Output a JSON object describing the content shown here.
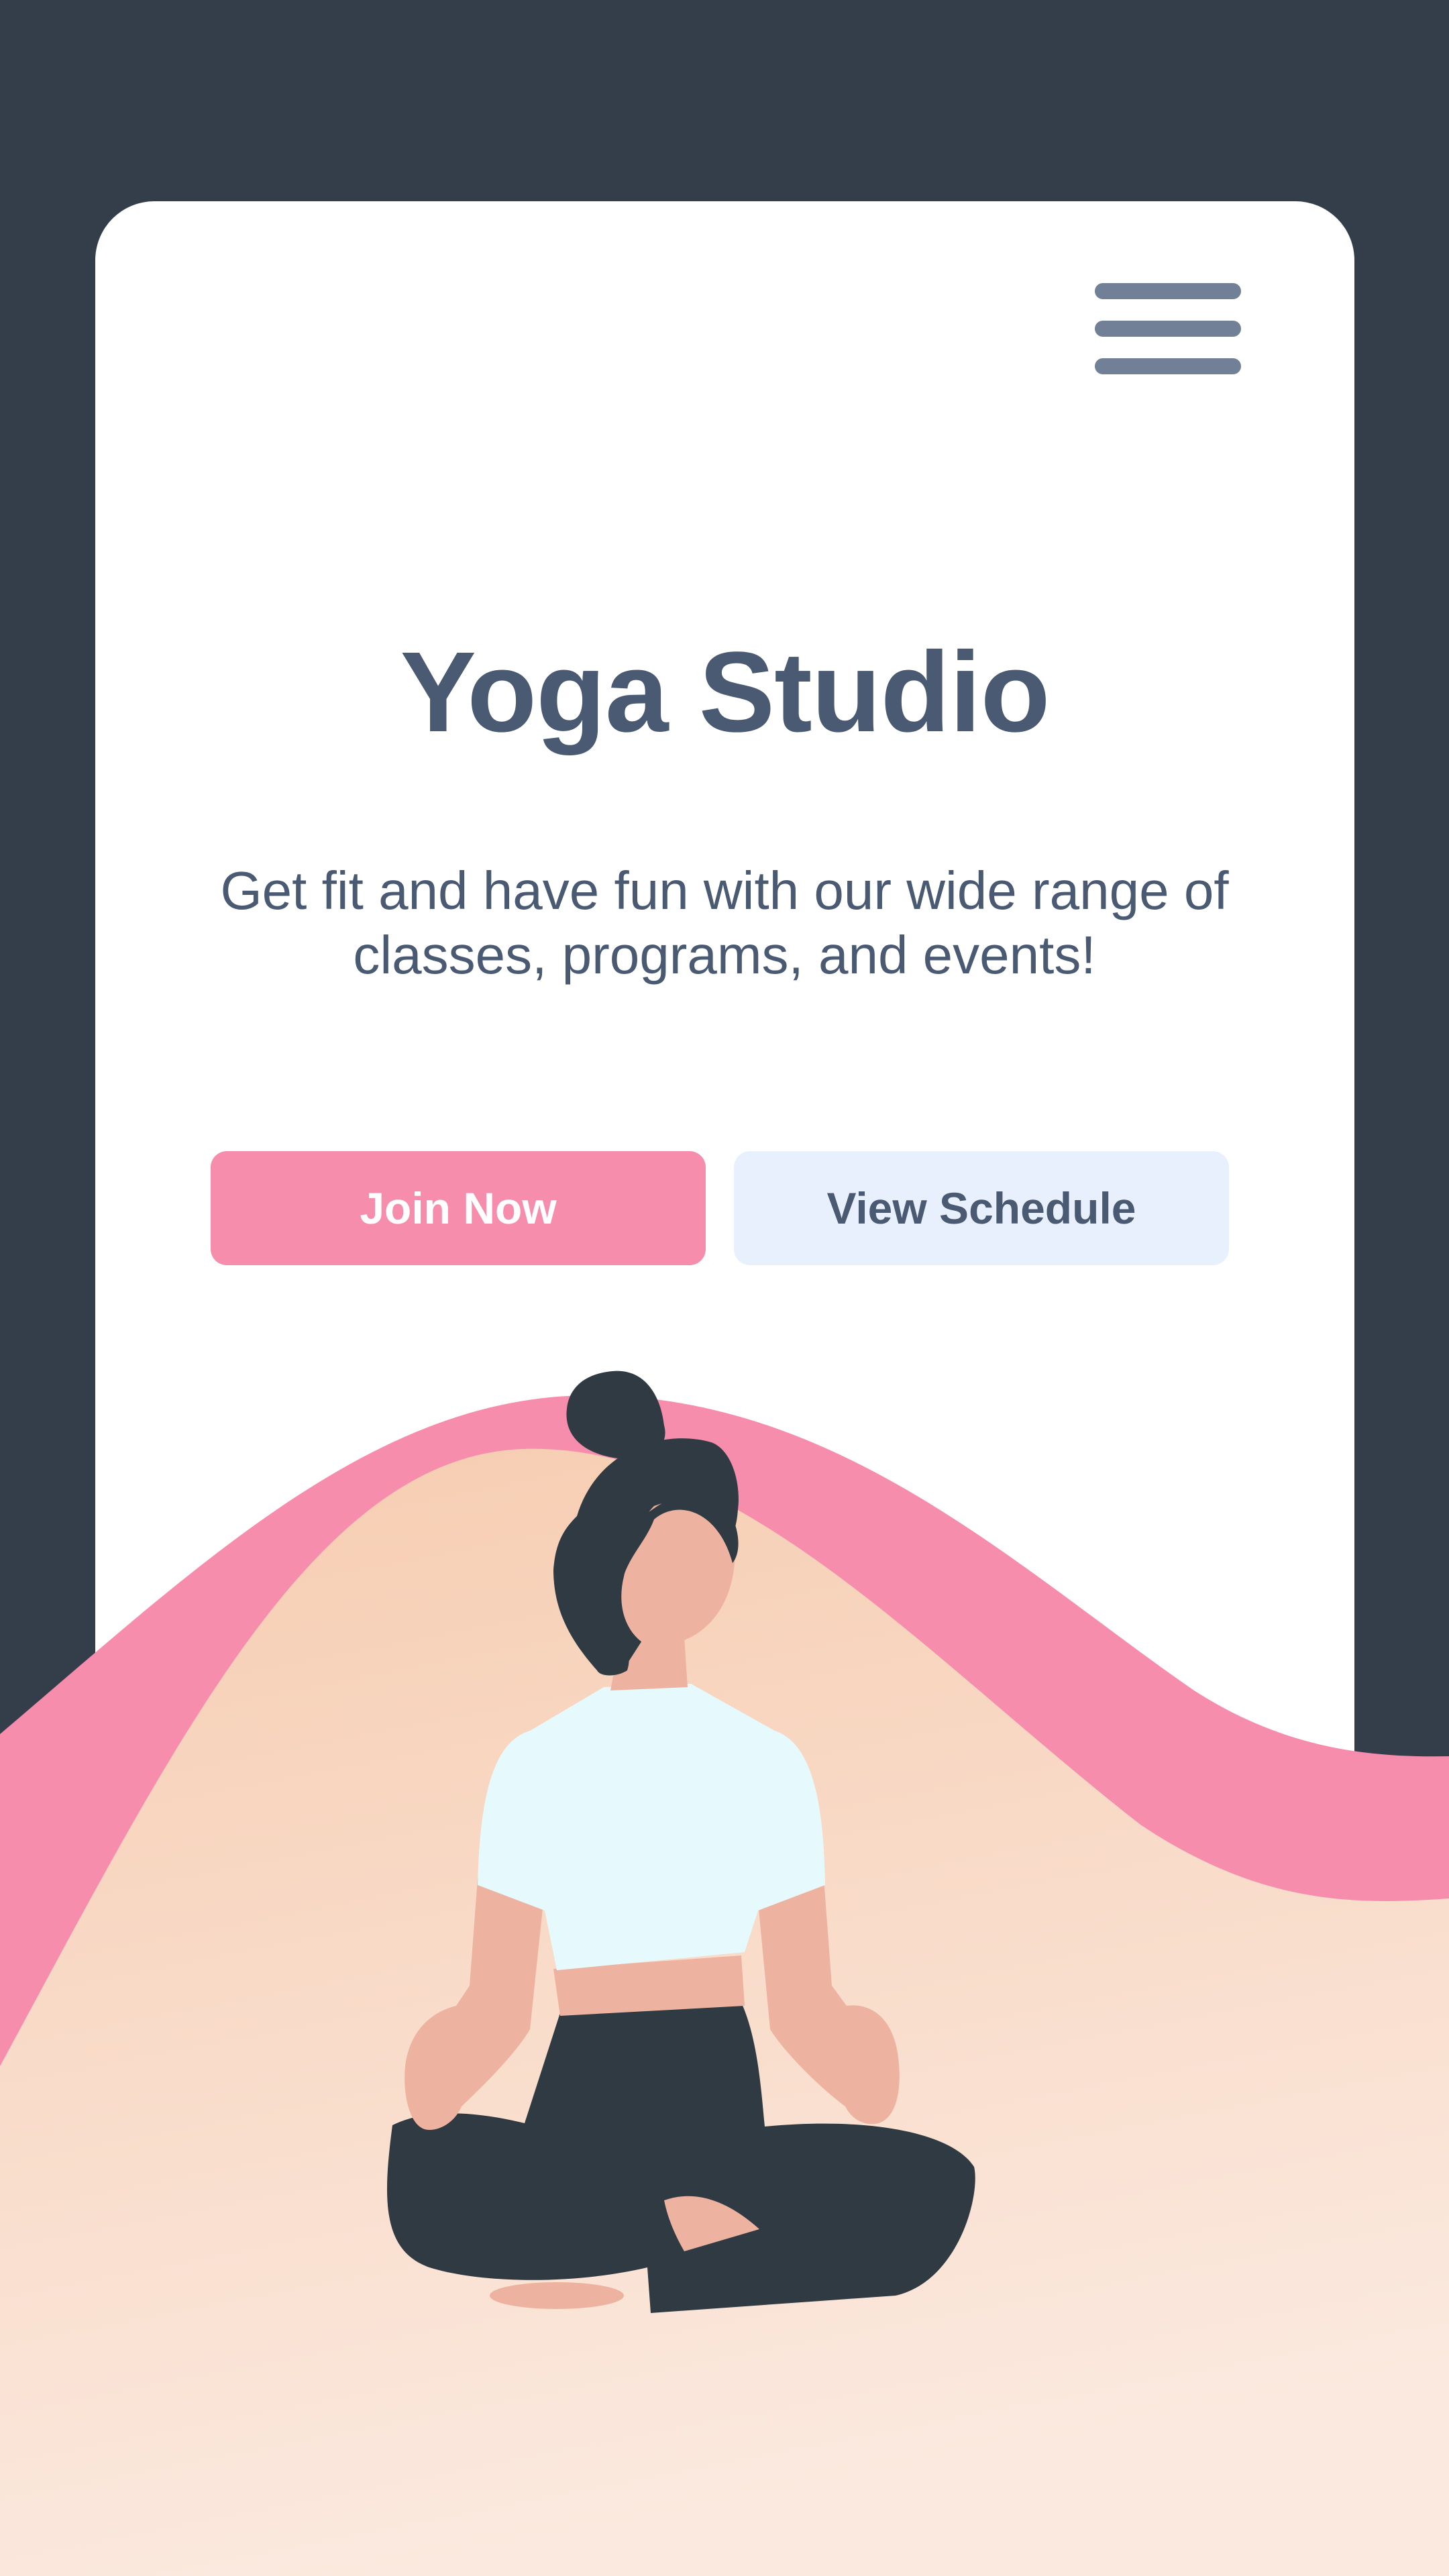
{
  "app": {
    "title": "Yoga Studio",
    "tagline": "Get fit and have fun with our wide range of classes, programs, and events!"
  },
  "nav": {
    "menu_icon": "hamburger-menu-icon"
  },
  "actions": {
    "join_label": "Join Now",
    "schedule_label": "View Schedule"
  },
  "illustration": {
    "subject": "woman-meditating-lotus-pose",
    "icon": "meditating-person-illustration"
  },
  "colors": {
    "background": "#333e4a",
    "card": "#ffffff",
    "text": "#4a5a73",
    "menu": "#718096",
    "accent_pink": "#f78dad",
    "secondary_button": "#e9f0fd",
    "sand_top": "#f6ccb0",
    "sand_bottom": "#fbe9df",
    "skin": "#eeb3a0",
    "hair_pants": "#2f3a42",
    "shirt": "#e6f9fd"
  }
}
